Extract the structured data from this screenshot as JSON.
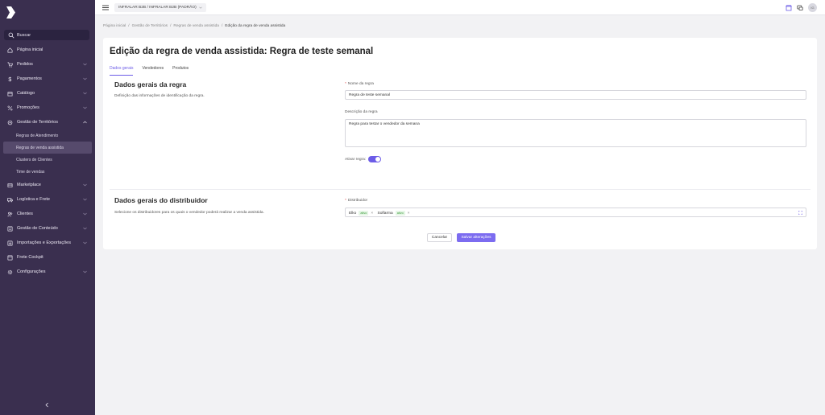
{
  "sidebar": {
    "search_label": "Buscar",
    "items": [
      {
        "label": "Página inicial",
        "icon": "home-icon"
      },
      {
        "label": "Pedidos",
        "icon": "cart-icon"
      },
      {
        "label": "Pagamentos",
        "icon": "dollar-icon"
      },
      {
        "label": "Catálogo",
        "icon": "box-icon"
      },
      {
        "label": "Promoções",
        "icon": "percent-icon"
      },
      {
        "label": "Gestão de Territórios",
        "icon": "location-icon"
      },
      {
        "label": "Marketplace",
        "icon": "store-icon"
      },
      {
        "label": "Logística e Frete",
        "icon": "truck-icon"
      },
      {
        "label": "Clientes",
        "icon": "users-icon"
      },
      {
        "label": "Gestão de Conteúdo",
        "icon": "content-icon"
      },
      {
        "label": "Importações e Exportações",
        "icon": "import-icon"
      },
      {
        "label": "Frete Cockpit",
        "icon": "dashboard-icon"
      },
      {
        "label": "Configurações",
        "icon": "gear-icon"
      }
    ],
    "sub_items": [
      "Regras de Atendimento",
      "Regras de venda assistida",
      "Clusters de Clientes",
      "Time de vendas"
    ]
  },
  "topbar": {
    "store_label": "INFRALAR B2B / INFRALAR B2B (PADRÃO)",
    "avatar_initials": "IG"
  },
  "breadcrumb": [
    "Página inicial",
    "Gestão de Territórios",
    "Regras de venda assistida",
    "Edição da regra de venda assistida"
  ],
  "page": {
    "title": "Edição da regra de venda assistida: Regra de teste semanal",
    "tabs": [
      "Dados gerais",
      "Vendedores",
      "Produtos"
    ]
  },
  "section1": {
    "title": "Dados gerais da regra",
    "description": "Definição das informações de identificação da regra.",
    "name_label": "Nome da regra",
    "name_value": "Regra de teste semanal",
    "desc_label": "Descrição da regra",
    "desc_value": "Regra para testar o vendedor da semana",
    "toggle_label": "Ativar regra:"
  },
  "section2": {
    "title": "Dados gerais do distribuidor",
    "description": "Selecione os distribuidores para os quais o vendedor poderá realizar a venda assistida.",
    "distributor_label": "Distribuidor",
    "tags": [
      {
        "name": "Elko",
        "status": "ativo"
      },
      {
        "name": "Solfarma",
        "status": "ativo"
      }
    ]
  },
  "actions": {
    "cancel_label": "Cancelar",
    "save_label": "Salvar alterações"
  },
  "colors": {
    "sidebar_bg": "#3a2f4f",
    "accent": "#6c5ce7"
  }
}
